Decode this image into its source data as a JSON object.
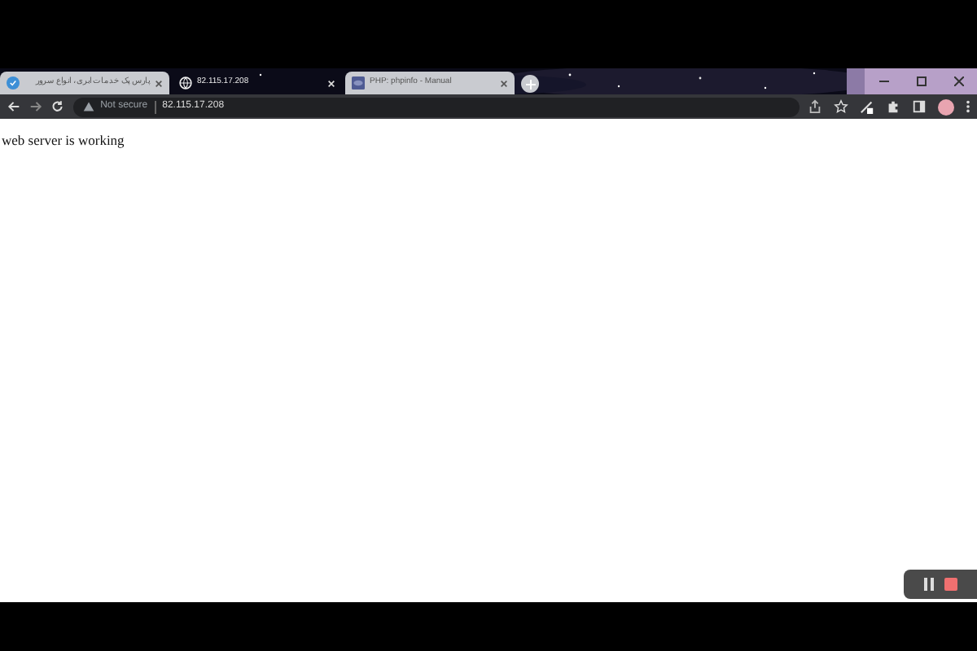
{
  "tabs": [
    {
      "title": "پارس پک خدمات ابری، انواع سرور",
      "kind": "shield",
      "selected": false
    },
    {
      "title": "82.115.17.208",
      "kind": "globe",
      "selected": true
    },
    {
      "title": "PHP: phpinfo - Manual",
      "kind": "php",
      "selected": false
    }
  ],
  "address_bar": {
    "security": "Not secure",
    "url": "82.115.17.208"
  },
  "page": {
    "text": "web server is working"
  }
}
